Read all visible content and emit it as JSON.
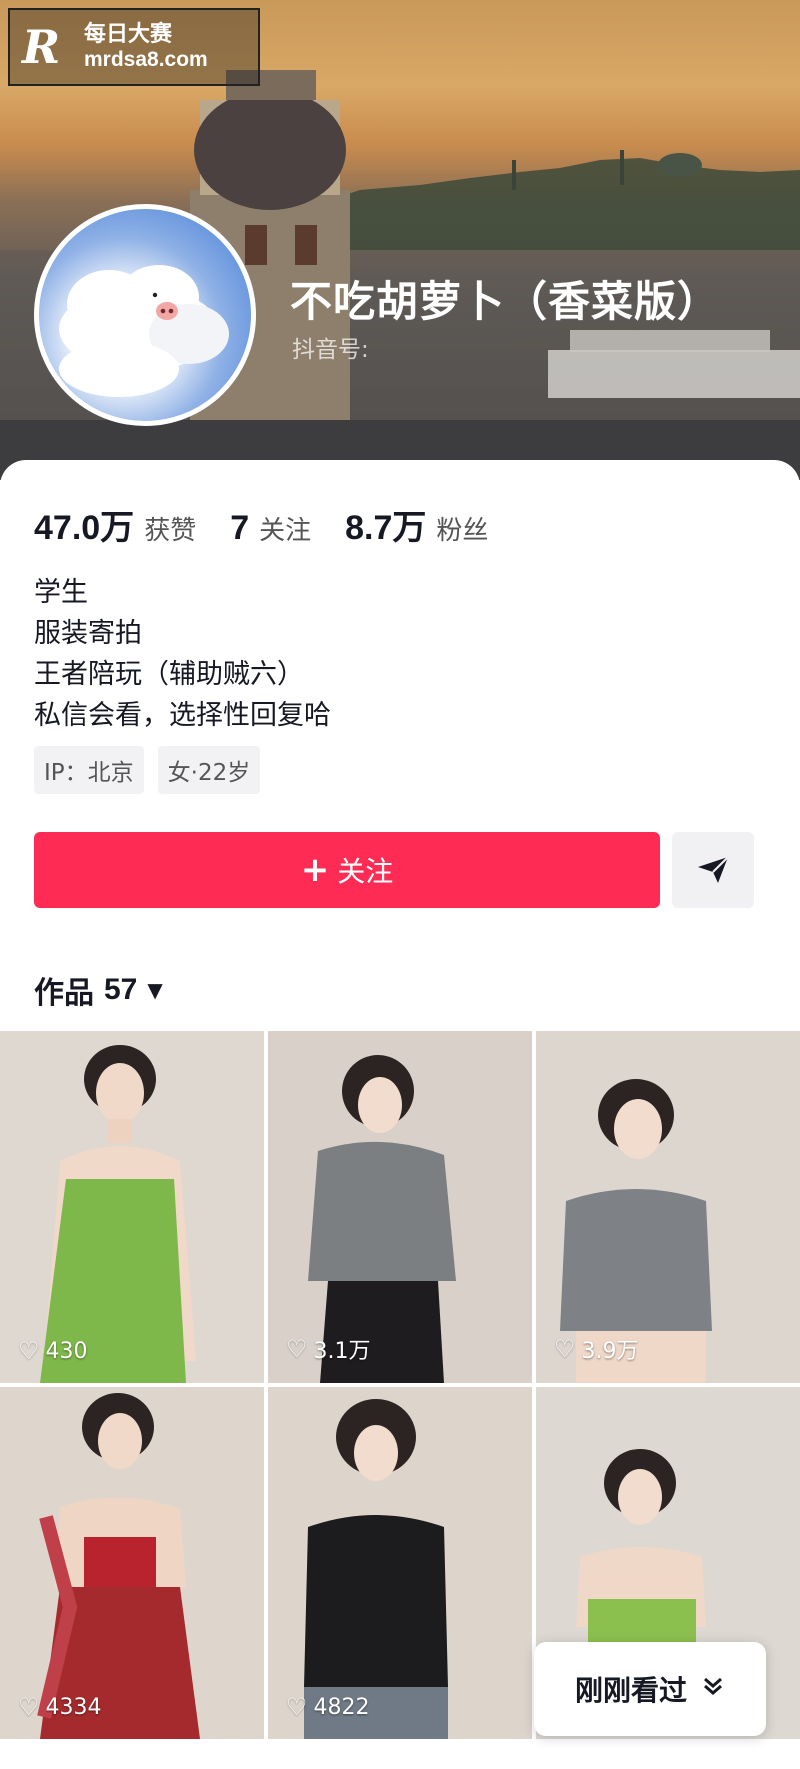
{
  "watermark": {
    "logo": "R",
    "line1": "每日大赛",
    "line2": "mrdsa8.com"
  },
  "profile": {
    "nickname": "不吃胡萝卜（香菜版）",
    "douyin_id_label": "抖音号:",
    "avatar_icon": "pig-cloud-avatar"
  },
  "stats": [
    {
      "value": "47.0万",
      "label": "获赞"
    },
    {
      "value": "7",
      "label": "关注"
    },
    {
      "value": "8.7万",
      "label": "粉丝"
    }
  ],
  "bio": [
    "学生",
    "服装寄拍",
    "王者陪玩（辅助贼六）",
    "私信会看，选择性回复哈"
  ],
  "tags": [
    "IP：北京",
    "女·22岁"
  ],
  "actions": {
    "follow_plus": "+",
    "follow_label": "关注",
    "share_icon": "send-icon"
  },
  "works": {
    "label": "作品",
    "count": "57",
    "caret": "▼"
  },
  "videos": [
    {
      "likes": "430"
    },
    {
      "likes": "3.1万"
    },
    {
      "likes": "3.9万"
    },
    {
      "likes": "4334"
    },
    {
      "likes": "4822"
    },
    {
      "likes": ""
    }
  ],
  "recent_chip": {
    "label": "刚刚看过",
    "icon": "double-chevron-down-icon"
  },
  "colors": {
    "accent": "#fe2c55",
    "text": "#161823",
    "muted": "#555555"
  }
}
